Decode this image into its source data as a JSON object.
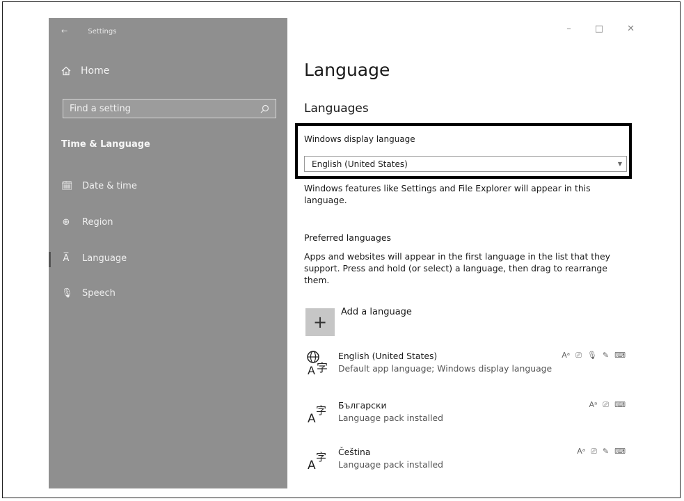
{
  "window": {
    "title": "Settings",
    "back_icon": "back-arrow-icon",
    "controls": {
      "minimize": "–",
      "maximize": "□",
      "close": "✕"
    }
  },
  "sidebar": {
    "home_label": "Home",
    "search_placeholder": "Find a setting",
    "section_heading": "Time & Language",
    "items": [
      {
        "label": "Date & time",
        "icon": "calendar-clock-icon",
        "selected": false
      },
      {
        "label": "Region",
        "icon": "globe-icon",
        "selected": false
      },
      {
        "label": "Language",
        "icon": "language-icon",
        "selected": true
      },
      {
        "label": "Speech",
        "icon": "microphone-icon",
        "selected": false
      }
    ]
  },
  "main": {
    "title": "Language",
    "languages_heading": "Languages",
    "display_language": {
      "label": "Windows display language",
      "value": "English (United States)",
      "help": "Windows features like Settings and File Explorer will appear in this language."
    },
    "preferred": {
      "heading": "Preferred languages",
      "description": "Apps and websites will appear in the first language in the list that they support. Press and hold (or select) a language, then drag to rearrange them.",
      "add_label": "Add a language",
      "languages": [
        {
          "name": "English (United States)",
          "desc": "Default app language; Windows display language",
          "icon": "globe-language-icon",
          "features": [
            "language-pack-icon",
            "display-icon",
            "speech-icon",
            "handwriting-icon",
            "keyboard-icon"
          ]
        },
        {
          "name": "Български",
          "desc": "Language pack installed",
          "icon": "language-icon",
          "features": [
            "language-pack-icon",
            "display-icon",
            "keyboard-icon"
          ]
        },
        {
          "name": "Čeština",
          "desc": "Language pack installed",
          "icon": "language-icon",
          "features": [
            "language-pack-icon",
            "display-icon",
            "handwriting-icon",
            "keyboard-icon"
          ]
        }
      ]
    }
  },
  "colors": {
    "sidebar_bg": "#8f8f8f",
    "highlight_border": "#000000"
  }
}
